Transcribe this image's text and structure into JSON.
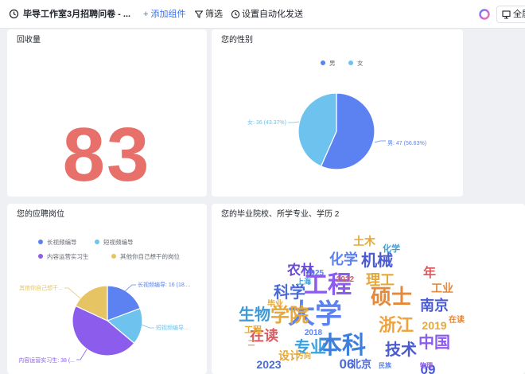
{
  "toolbar": {
    "title": "毕导工作室3月招聘问卷 - ...",
    "add_component": "+ 添加组件",
    "filter": "筛选",
    "automation": "设置自动化发送",
    "fullscreen": "全屏",
    "icons": [
      "history-icon",
      "filter-icon",
      "automation-icon",
      "ai-assistant-icon",
      "fullscreen-icon"
    ]
  },
  "colors": {
    "accent": "#3370ff",
    "big_number": "#e8706a",
    "male": "#5b82f0",
    "female": "#6ec3ee",
    "pos1": "#5b82f0",
    "pos2": "#6ec3ee",
    "pos3": "#8c5ced",
    "pos4": "#e6c363"
  },
  "cards": {
    "responses": {
      "title": "回收量",
      "value": "83"
    },
    "gender": {
      "title": "您的性别"
    },
    "position": {
      "title": "您的应聘岗位"
    },
    "wordcloud": {
      "title": "您的毕业院校、所学专业、学历 2",
      "words": [
        "大学",
        "工程",
        "本科",
        "硕士",
        "学院",
        "科学",
        "浙江",
        "技术",
        "专业",
        "生物",
        "中国",
        "南京",
        "机械",
        "化学",
        "理工",
        "农林",
        "在读",
        "土木",
        "设计",
        "北京",
        "2023",
        "2019",
        "2025",
        "2022",
        "2018",
        "09",
        "06",
        "年",
        "工业",
        "上海",
        "毕业",
        "方向",
        "民族",
        "物理",
        "化学",
        "在读",
        "工程",
        "二"
      ]
    }
  },
  "chart_data": [
    {
      "type": "pie",
      "title": "您的性别",
      "categories": [
        "男",
        "女"
      ],
      "values": [
        47,
        36
      ],
      "percents": [
        56.63,
        43.37
      ],
      "data_labels": [
        "男: 47 (56.63%)",
        "女: 36 (43.37%)"
      ],
      "legend": "top"
    },
    {
      "type": "pie",
      "title": "您的应聘岗位",
      "categories": [
        "长视频编导",
        "短视频编导",
        "内容运营实习生",
        "其他你自己想干的岗位"
      ],
      "values": [
        16,
        14,
        38,
        15
      ],
      "data_labels": [
        "长视频编导: 16 (18....",
        "短视频编导...",
        "内容运营实习生: 38 (...",
        "其他你自己想干..."
      ],
      "legend": "top"
    }
  ]
}
